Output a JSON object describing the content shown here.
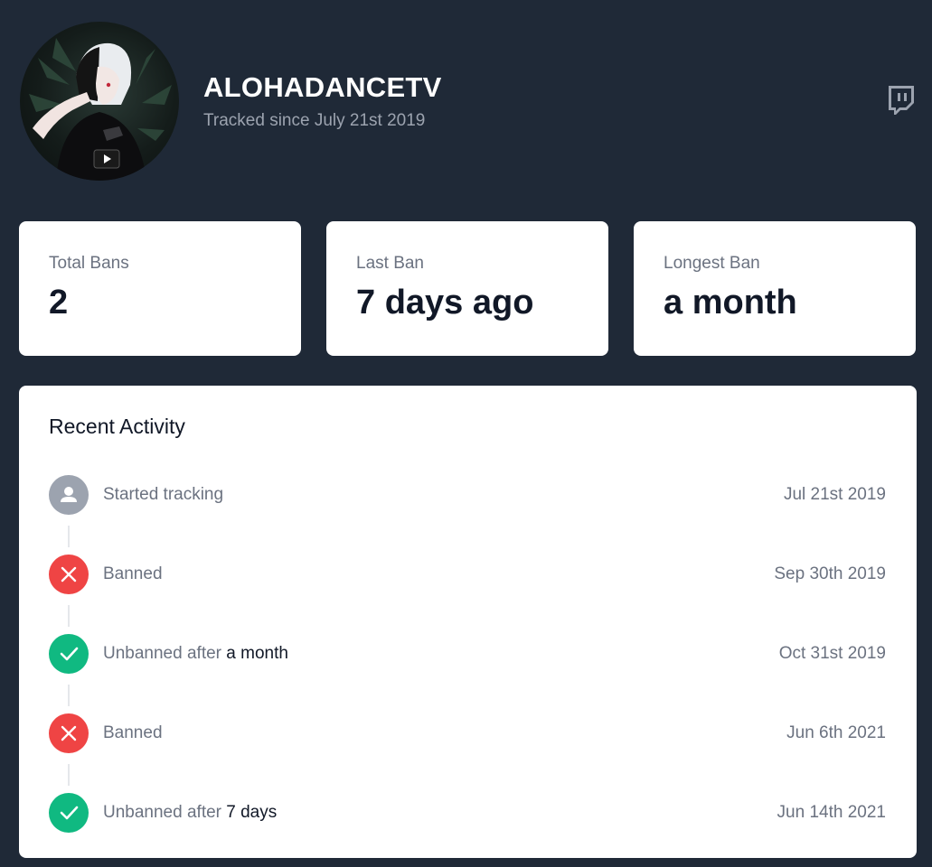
{
  "colors": {
    "background": "#1f2937",
    "neutral_icon": "#9ca3af",
    "banned_icon": "#ef4444",
    "unbanned_icon": "#10b981"
  },
  "header": {
    "channel_name": "ALOHADANCETV",
    "tracked_since": "Tracked since July 21st 2019",
    "avatar_icon": "channel-avatar",
    "platform_icon": "twitch-icon"
  },
  "stats": [
    {
      "label": "Total Bans",
      "value": "2"
    },
    {
      "label": "Last Ban",
      "value": "7 days ago"
    },
    {
      "label": "Longest Ban",
      "value": "a month"
    }
  ],
  "activity": {
    "title": "Recent Activity",
    "events": [
      {
        "type": "tracking",
        "icon": "user-icon",
        "text": "Started tracking",
        "highlight": "",
        "date": "Jul 21st 2019"
      },
      {
        "type": "banned",
        "icon": "x-icon",
        "text": "Banned",
        "highlight": "",
        "date": "Sep 30th 2019"
      },
      {
        "type": "unbanned",
        "icon": "check-icon",
        "text": "Unbanned after ",
        "highlight": "a month",
        "date": "Oct 31st 2019"
      },
      {
        "type": "banned",
        "icon": "x-icon",
        "text": "Banned",
        "highlight": "",
        "date": "Jun 6th 2021"
      },
      {
        "type": "unbanned",
        "icon": "check-icon",
        "text": "Unbanned after ",
        "highlight": "7 days",
        "date": "Jun 14th 2021"
      }
    ]
  }
}
